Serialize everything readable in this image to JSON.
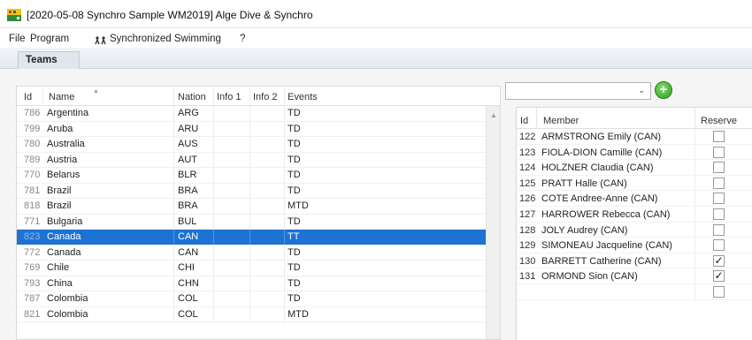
{
  "window": {
    "title": "[2020-05-08 Synchro Sample WM2019] Alge Dive & Synchro"
  },
  "menu": {
    "items": [
      "File",
      "Program",
      "Synchronized Swimming",
      "?"
    ]
  },
  "tabs": [
    {
      "label": "Teams",
      "active": true
    }
  ],
  "teams_grid": {
    "columns": [
      "Id",
      "Name",
      "Nation",
      "Info 1",
      "Info 2",
      "Events"
    ],
    "rows": [
      {
        "id": "786",
        "name": "Argentina",
        "nation": "ARG",
        "info1": "",
        "info2": "",
        "events": "TD"
      },
      {
        "id": "799",
        "name": "Aruba",
        "nation": "ARU",
        "info1": "",
        "info2": "",
        "events": "TD"
      },
      {
        "id": "780",
        "name": "Australia",
        "nation": "AUS",
        "info1": "",
        "info2": "",
        "events": "TD"
      },
      {
        "id": "789",
        "name": "Austria",
        "nation": "AUT",
        "info1": "",
        "info2": "",
        "events": "TD"
      },
      {
        "id": "770",
        "name": "Belarus",
        "nation": "BLR",
        "info1": "",
        "info2": "",
        "events": "TD"
      },
      {
        "id": "781",
        "name": "Brazil",
        "nation": "BRA",
        "info1": "",
        "info2": "",
        "events": "TD"
      },
      {
        "id": "818",
        "name": "Brazil",
        "nation": "BRA",
        "info1": "",
        "info2": "",
        "events": "MTD"
      },
      {
        "id": "771",
        "name": "Bulgaria",
        "nation": "BUL",
        "info1": "",
        "info2": "",
        "events": "TD"
      },
      {
        "id": "823",
        "name": "Canada",
        "nation": "CAN",
        "info1": "",
        "info2": "",
        "events": "TT",
        "selected": true
      },
      {
        "id": "772",
        "name": "Canada",
        "nation": "CAN",
        "info1": "",
        "info2": "",
        "events": "TD"
      },
      {
        "id": "769",
        "name": "Chile",
        "nation": "CHI",
        "info1": "",
        "info2": "",
        "events": "TD"
      },
      {
        "id": "793",
        "name": "China",
        "nation": "CHN",
        "info1": "",
        "info2": "",
        "events": "TD"
      },
      {
        "id": "787",
        "name": "Colombia",
        "nation": "COL",
        "info1": "",
        "info2": "",
        "events": "TD"
      },
      {
        "id": "821",
        "name": "Colombia",
        "nation": "COL",
        "info1": "",
        "info2": "",
        "events": "MTD"
      }
    ]
  },
  "members_panel": {
    "combo_value": "",
    "columns": [
      "Id",
      "Member",
      "Reserve"
    ],
    "rows": [
      {
        "id": "122",
        "member": "ARMSTRONG Emily (CAN)",
        "reserve": false
      },
      {
        "id": "123",
        "member": "FIOLA-DION Camille (CAN)",
        "reserve": false
      },
      {
        "id": "124",
        "member": "HOLZNER Claudia (CAN)",
        "reserve": false
      },
      {
        "id": "125",
        "member": "PRATT Halle (CAN)",
        "reserve": false
      },
      {
        "id": "126",
        "member": "COTE Andree-Anne (CAN)",
        "reserve": false
      },
      {
        "id": "127",
        "member": "HARROWER Rebecca (CAN)",
        "reserve": false
      },
      {
        "id": "128",
        "member": "JOLY Audrey (CAN)",
        "reserve": false
      },
      {
        "id": "129",
        "member": "SIMONEAU Jacqueline (CAN)",
        "reserve": false
      },
      {
        "id": "130",
        "member": "BARRETT Catherine (CAN)",
        "reserve": true
      },
      {
        "id": "131",
        "member": "ORMOND Sion (CAN)",
        "reserve": true
      },
      {
        "id": "",
        "member": "",
        "reserve": false
      }
    ]
  },
  "colors": {
    "selection": "#1e73d2",
    "add_button": "#2f9e1f"
  }
}
